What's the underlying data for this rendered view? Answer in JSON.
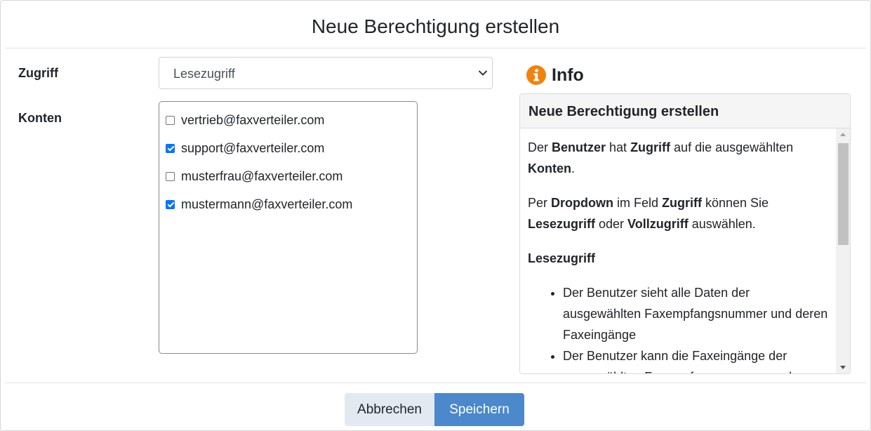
{
  "dialog": {
    "title": "Neue Berechtigung erstellen"
  },
  "form": {
    "zugriff_label": "Zugriff",
    "zugriff_value": "Lesezugriff",
    "konten_label": "Konten",
    "accounts": [
      {
        "email": "vertrieb@faxverteiler.com",
        "checked": false
      },
      {
        "email": "support@faxverteiler.com",
        "checked": true
      },
      {
        "email": "musterfrau@faxverteiler.com",
        "checked": false
      },
      {
        "email": "mustermann@faxverteiler.com",
        "checked": true
      }
    ]
  },
  "info": {
    "heading": "Info",
    "card_title": "Neue Berechtigung erstellen",
    "p1": [
      "Der ",
      "Benutzer",
      " hat ",
      "Zugriff",
      " auf die ausgewählten ",
      "Konten",
      "."
    ],
    "p2": [
      "Per ",
      "Dropdown",
      " im Feld ",
      "Zugriff",
      " können Sie ",
      "Lesezugriff",
      " oder ",
      "Vollzugriff",
      " auswählen."
    ],
    "section_title": "Lesezugriff",
    "bullets": [
      "Der Benutzer sieht alle Daten der ausgewählten Faxempfangsnummer und deren Faxeingänge",
      "Der Benutzer kann die Faxeingänge der ausgewählten Faxempfangsnummer und"
    ]
  },
  "buttons": {
    "cancel": "Abbrechen",
    "save": "Speichern"
  },
  "colors": {
    "info_icon": "#f0830c",
    "save_button": "#4b88cc",
    "cancel_button": "#e3e9f1",
    "checkbox_checked": "#0075ff"
  }
}
